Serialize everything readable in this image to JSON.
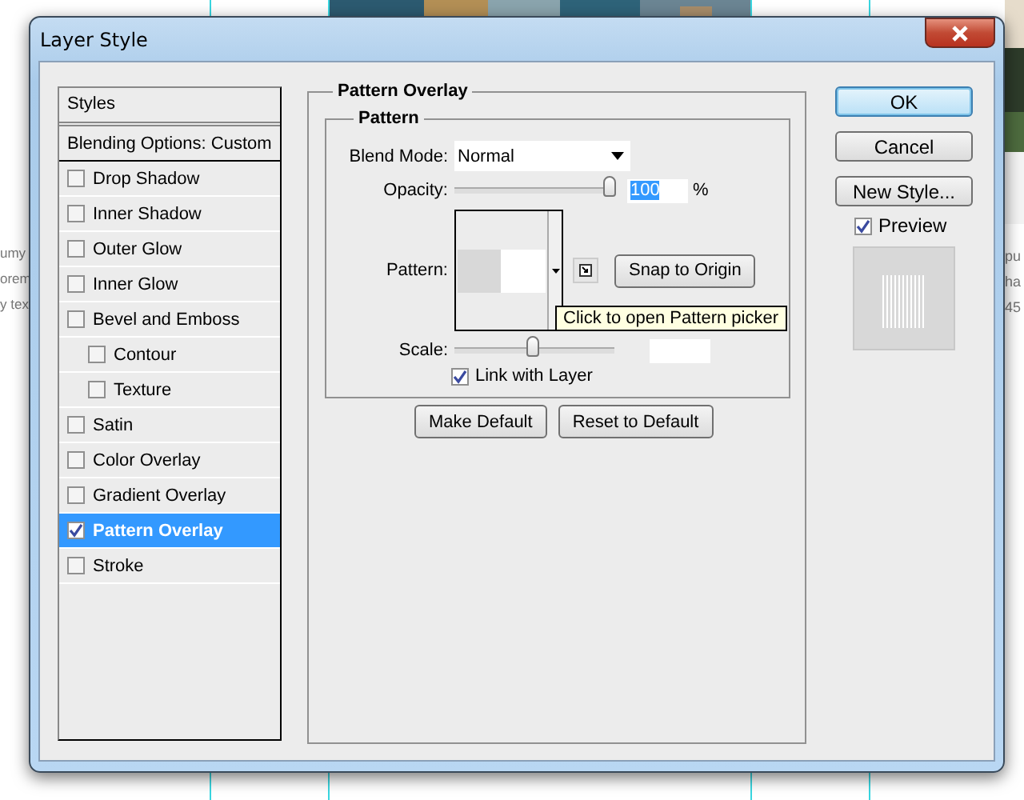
{
  "background": {
    "left_text": [
      "umy",
      "orem",
      "y tex"
    ],
    "right_text": [
      "pu",
      "ha",
      "45"
    ]
  },
  "window": {
    "title": "Layer Style"
  },
  "styles_panel": {
    "header": "Styles",
    "blending_options": "Blending Options: Custom",
    "items": [
      {
        "label": "Drop Shadow",
        "checked": false,
        "selected": false
      },
      {
        "label": "Inner Shadow",
        "checked": false,
        "selected": false
      },
      {
        "label": "Outer Glow",
        "checked": false,
        "selected": false
      },
      {
        "label": "Inner Glow",
        "checked": false,
        "selected": false
      },
      {
        "label": "Bevel and Emboss",
        "checked": false,
        "selected": false,
        "children": [
          {
            "label": "Contour",
            "checked": false,
            "selected": false
          },
          {
            "label": "Texture",
            "checked": false,
            "selected": false
          }
        ]
      },
      {
        "label": "Satin",
        "checked": false,
        "selected": false
      },
      {
        "label": "Color Overlay",
        "checked": false,
        "selected": false
      },
      {
        "label": "Gradient Overlay",
        "checked": false,
        "selected": false
      },
      {
        "label": "Pattern Overlay",
        "checked": true,
        "selected": true
      },
      {
        "label": "Stroke",
        "checked": false,
        "selected": false
      }
    ]
  },
  "pattern_overlay": {
    "title": "Pattern Overlay",
    "group": {
      "title": "Pattern",
      "blend_mode": {
        "label": "Blend Mode:",
        "value": "Normal"
      },
      "opacity": {
        "label": "Opacity:",
        "level": 1,
        "value": "100",
        "value_selected": true,
        "unit": "%"
      },
      "pattern": {
        "label": "Pattern:"
      },
      "snap_button": "Snap to Origin",
      "scale": {
        "label": "Scale:",
        "level": 0.5
      },
      "link_with_layer": {
        "label": "Link with Layer",
        "checked": true
      }
    },
    "buttons": [
      "Make Default",
      "Reset to Default"
    ]
  },
  "tooltip": "Click to open Pattern picker",
  "actions": [
    {
      "label": "OK",
      "default": true
    },
    {
      "label": "Cancel",
      "default": false
    },
    {
      "label": "New Style...",
      "default": false
    }
  ],
  "preview": {
    "label": "Preview",
    "checked": true
  }
}
